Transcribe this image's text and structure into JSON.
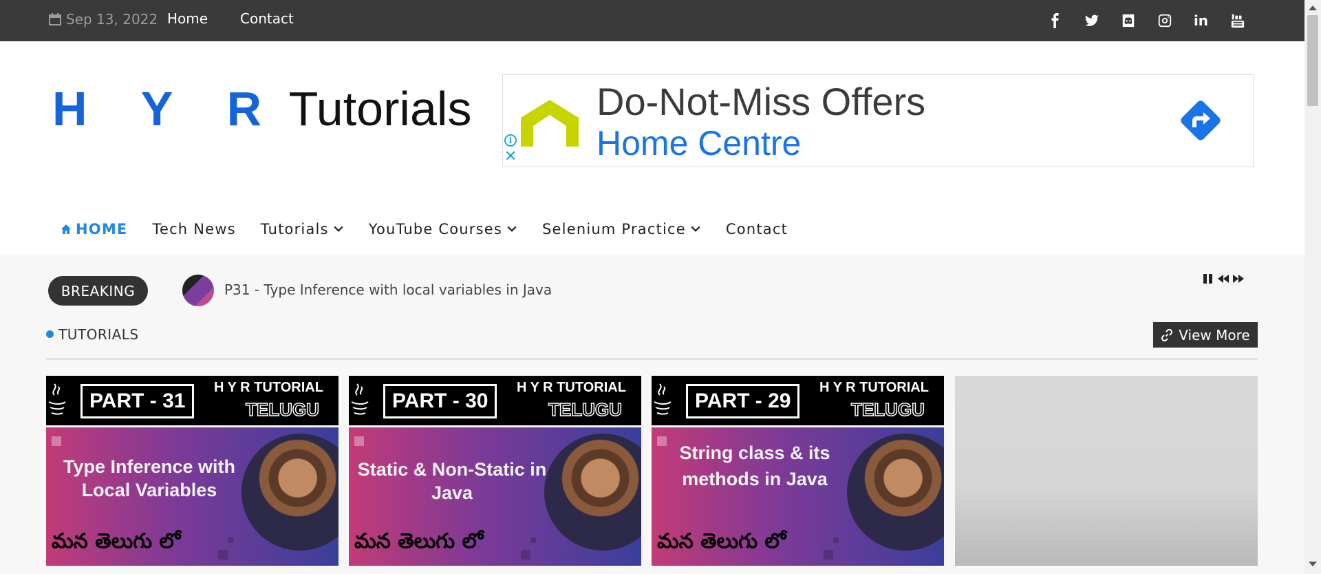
{
  "topbar": {
    "date": "Sep 13, 2022",
    "links": [
      "Home",
      "Contact"
    ],
    "social": [
      "facebook-icon",
      "twitter-icon",
      "discord-icon",
      "instagram-icon",
      "linkedin-icon",
      "youtube-icon"
    ],
    "linkedin_text": "in"
  },
  "logo": {
    "part1": "H Y R",
    "part2": "Tutorials"
  },
  "ad": {
    "headline": "Do-Not-Miss Offers",
    "brand": "Home Centre",
    "info_glyph": "i",
    "close_glyph": "✕"
  },
  "nav": {
    "home": "HOME",
    "tech_news": "Tech News",
    "tutorials": "Tutorials",
    "youtube_courses": "YouTube Courses",
    "selenium_practice": "Selenium Practice",
    "contact": "Contact"
  },
  "breaking": {
    "label": "BREAKING",
    "headline": "P31 - Type Inference with local variables in Java"
  },
  "section": {
    "title": "TUTORIALS",
    "view_more": "View More"
  },
  "cards": [
    {
      "part": "PART - 31",
      "channel": "H Y R TUTORIAL",
      "language": "TELUGU",
      "title": "Type Inference with Local Variables",
      "telugu": "మన తెలుగు లో"
    },
    {
      "part": "PART - 30",
      "channel": "H Y R TUTORIAL",
      "language": "TELUGU",
      "title": "Static & Non-Static in Java",
      "telugu": "మన తెలుగు లో"
    },
    {
      "part": "PART - 29",
      "channel": "H Y R TUTORIAL",
      "language": "TELUGU",
      "title": "String class & its methods in Java",
      "telugu": "మన తెలుగు లో"
    }
  ],
  "colors": {
    "topbar_bg": "#3a3a3a",
    "accent_blue": "#1e88e5",
    "logo_blue": "#1565d8",
    "ad_brand_blue": "#1a73e8",
    "ad_logo_green": "#c8d400",
    "dark_button": "#333333"
  }
}
